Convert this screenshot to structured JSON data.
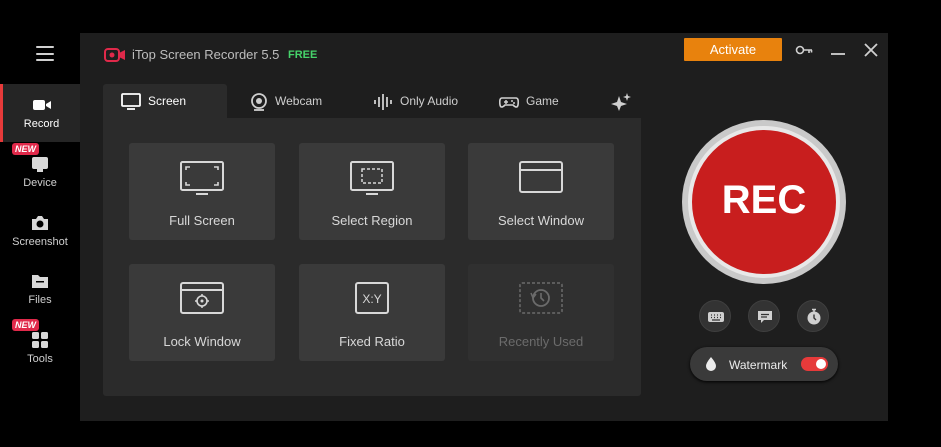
{
  "sidebar": {
    "items": [
      {
        "label": "Record",
        "icon": "video-camera-icon",
        "active": true
      },
      {
        "label": "Device",
        "icon": "device-icon",
        "badge": "NEW"
      },
      {
        "label": "Screenshot",
        "icon": "camera-icon"
      },
      {
        "label": "Files",
        "icon": "folder-icon"
      },
      {
        "label": "Tools",
        "icon": "grid-icon",
        "badge": "NEW"
      }
    ]
  },
  "header": {
    "title": "iTop Screen Recorder 5.5",
    "edition": "FREE",
    "activate_label": "Activate"
  },
  "tabs": [
    {
      "label": "Screen",
      "icon": "monitor-icon",
      "active": true
    },
    {
      "label": "Webcam",
      "icon": "webcam-icon"
    },
    {
      "label": "Only Audio",
      "icon": "audio-wave-icon"
    },
    {
      "label": "Game",
      "icon": "gamepad-icon"
    },
    {
      "label": "",
      "icon": "sparkle-icon"
    }
  ],
  "modes": [
    {
      "label": "Full Screen",
      "icon": "full-screen-icon"
    },
    {
      "label": "Select Region",
      "icon": "select-region-icon"
    },
    {
      "label": "Select Window",
      "icon": "select-window-icon"
    },
    {
      "label": "Lock Window",
      "icon": "lock-window-icon"
    },
    {
      "label": "Fixed Ratio",
      "icon": "fixed-ratio-icon",
      "icon_text": "X:Y"
    },
    {
      "label": "Recently Used",
      "icon": "history-icon",
      "disabled": true
    }
  ],
  "record": {
    "label": "REC",
    "watermark_label": "Watermark",
    "watermark_enabled": true
  },
  "colors": {
    "accent_red": "#c81e1e",
    "activate_orange": "#e8820d",
    "free_green": "#46d26a",
    "badge_pink": "#e0294a"
  }
}
